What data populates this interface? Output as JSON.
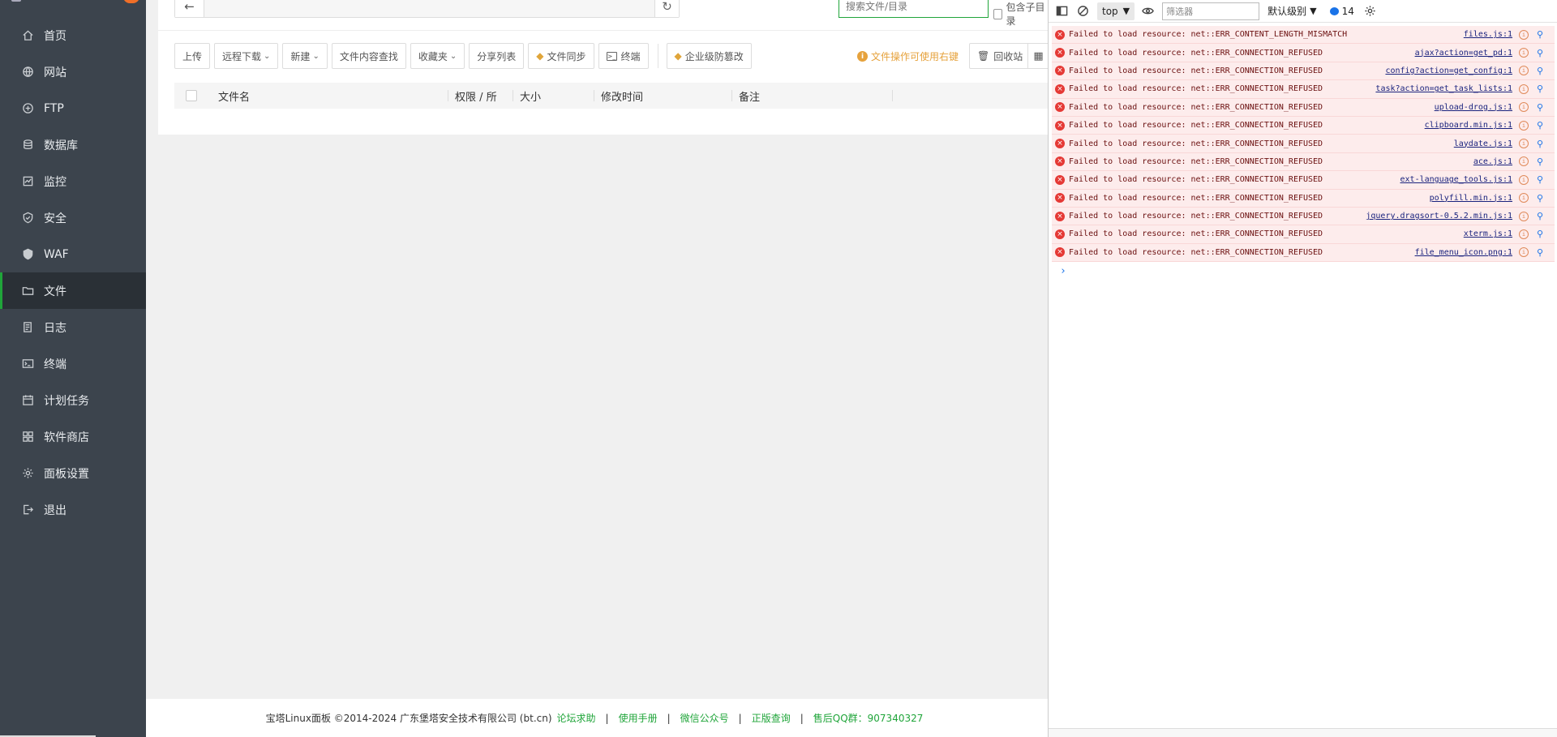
{
  "sidebar": {
    "items": [
      {
        "label": "首页",
        "icon": "home-icon",
        "active": false
      },
      {
        "label": "网站",
        "icon": "globe-icon",
        "active": false
      },
      {
        "label": "FTP",
        "icon": "ftp-icon",
        "active": false
      },
      {
        "label": "数据库",
        "icon": "database-icon",
        "active": false
      },
      {
        "label": "监控",
        "icon": "monitor-icon",
        "active": false
      },
      {
        "label": "安全",
        "icon": "shield-icon",
        "active": false
      },
      {
        "label": "WAF",
        "icon": "waf-shield-icon",
        "active": false
      },
      {
        "label": "文件",
        "icon": "folder-icon",
        "active": true
      },
      {
        "label": "日志",
        "icon": "log-icon",
        "active": false
      },
      {
        "label": "终端",
        "icon": "terminal-icon",
        "active": false
      },
      {
        "label": "计划任务",
        "icon": "calendar-icon",
        "active": false
      },
      {
        "label": "软件商店",
        "icon": "apps-icon",
        "active": false
      },
      {
        "label": "面板设置",
        "icon": "gear-icon",
        "active": false
      },
      {
        "label": "退出",
        "icon": "logout-icon",
        "active": false
      }
    ]
  },
  "filebar": {
    "search_placeholder": "搜索文件/目录",
    "include_subdir_label": "包含子目录"
  },
  "toolbar": {
    "upload": "上传",
    "remote_download": "远程下载",
    "new": "新建",
    "content_search": "文件内容查找",
    "favorites": "收藏夹",
    "share_list": "分享列表",
    "file_sync": "文件同步",
    "terminal": "终端",
    "enterprise_tamper": "企业级防篡改",
    "hint": "文件操作可使用右键",
    "recycle_bin": "回收站"
  },
  "table": {
    "columns": [
      "文件名",
      "权限 / 所",
      "大小",
      "修改时间",
      "备注"
    ]
  },
  "footer": {
    "copyright": "宝塔Linux面板 ©2014-2024 广东堡塔安全技术有限公司 (bt.cn)",
    "forum": "论坛求助",
    "manual": "使用手册",
    "wechat": "微信公众号",
    "license": "正版查询",
    "qq": "售后QQ群：907340327"
  },
  "devtools": {
    "context": "top",
    "filter_placeholder": "筛选器",
    "level": "默认级别",
    "issues_count": "14",
    "logs": [
      {
        "message": "Failed to load resource: net::ERR_CONTENT_LENGTH_MISMATCH",
        "source": "files.js:1"
      },
      {
        "message": "Failed to load resource: net::ERR_CONNECTION_REFUSED",
        "source": "ajax?action=get_pd:1"
      },
      {
        "message": "Failed to load resource: net::ERR_CONNECTION_REFUSED",
        "source": "config?action=get_config:1"
      },
      {
        "message": "Failed to load resource: net::ERR_CONNECTION_REFUSED",
        "source": "task?action=get_task_lists:1"
      },
      {
        "message": "Failed to load resource: net::ERR_CONNECTION_REFUSED",
        "source": "upload-drog.js:1"
      },
      {
        "message": "Failed to load resource: net::ERR_CONNECTION_REFUSED",
        "source": "clipboard.min.js:1"
      },
      {
        "message": "Failed to load resource: net::ERR_CONNECTION_REFUSED",
        "source": "laydate.js:1"
      },
      {
        "message": "Failed to load resource: net::ERR_CONNECTION_REFUSED",
        "source": "ace.js:1"
      },
      {
        "message": "Failed to load resource: net::ERR_CONNECTION_REFUSED",
        "source": "ext-language_tools.js:1"
      },
      {
        "message": "Failed to load resource: net::ERR_CONNECTION_REFUSED",
        "source": "polyfill.min.js:1"
      },
      {
        "message": "Failed to load resource: net::ERR_CONNECTION_REFUSED",
        "source": "jquery.dragsort-0.5.2.min.js:1"
      },
      {
        "message": "Failed to load resource: net::ERR_CONNECTION_REFUSED",
        "source": "xterm.js:1"
      },
      {
        "message": "Failed to load resource: net::ERR_CONNECTION_REFUSED",
        "source": "file_menu_icon.png:1"
      }
    ],
    "prompt": "›"
  },
  "colors": {
    "sidebar_bg": "#3c444d",
    "accent_green": "#20a53a",
    "warning_orange": "#e6a23c",
    "error_row_bg": "#fdecec"
  }
}
